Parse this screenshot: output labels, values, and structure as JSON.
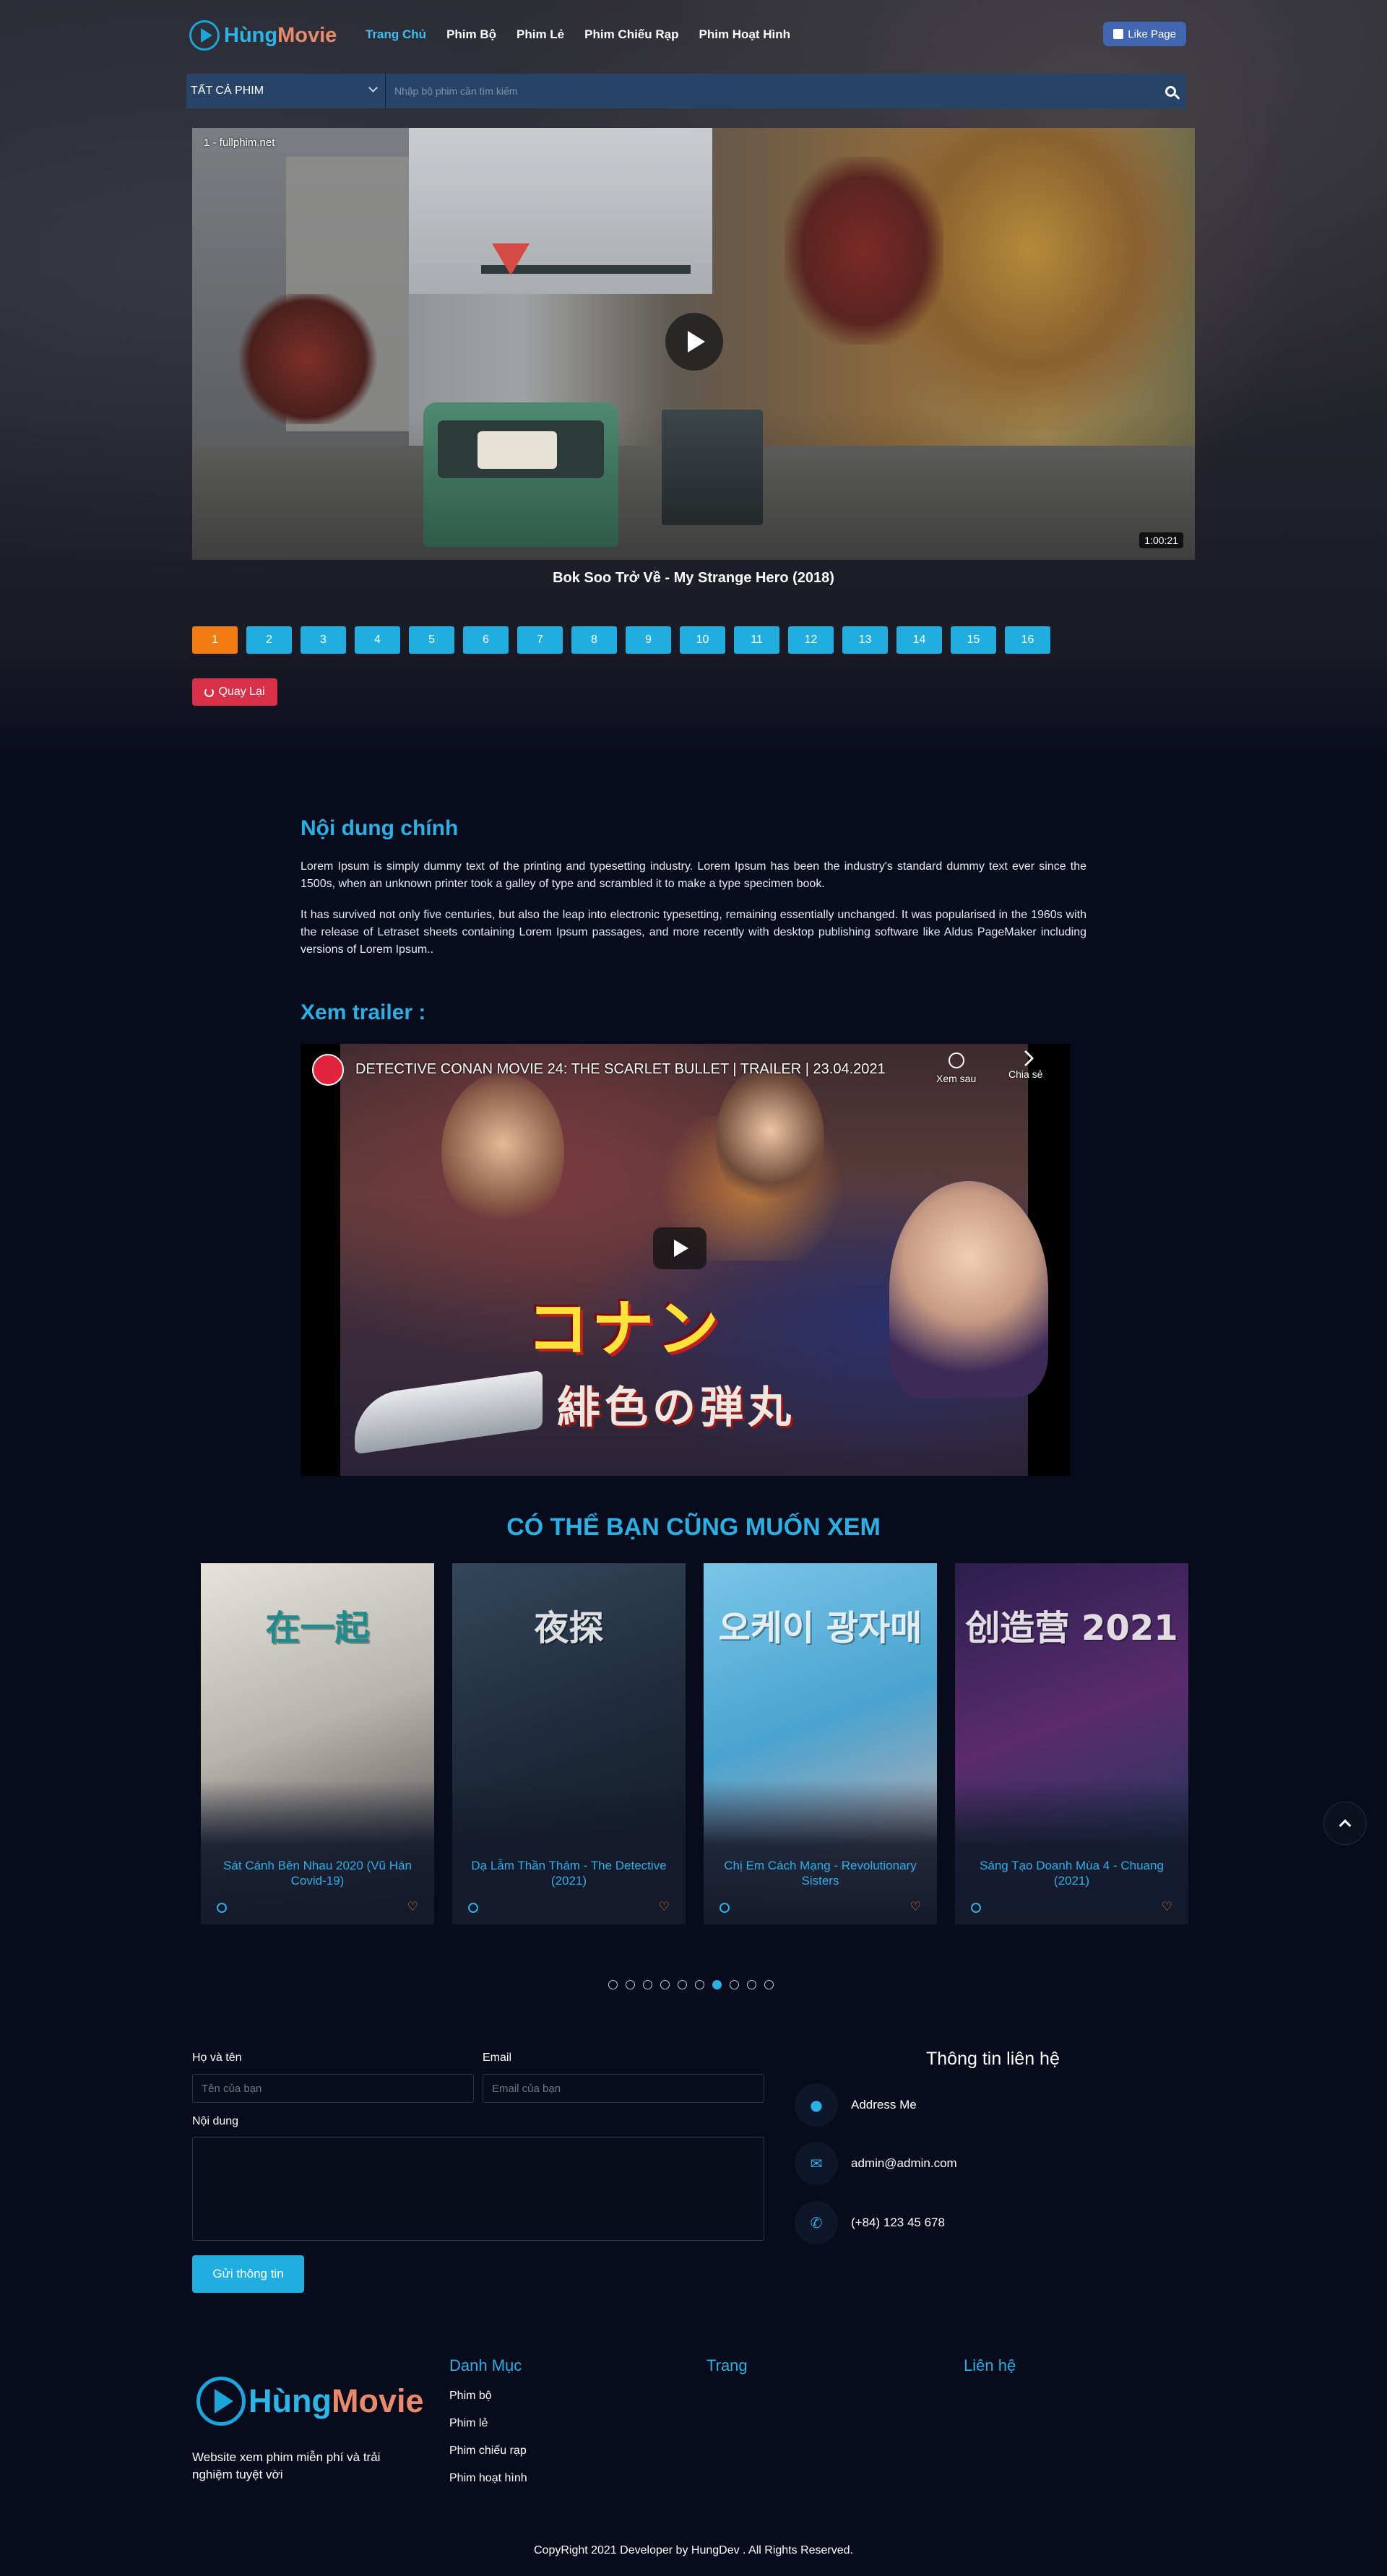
{
  "brand": {
    "part1": "Hùng",
    "part2": "Movie"
  },
  "nav": {
    "links": [
      "Trang Chủ",
      "Phim Bộ",
      "Phim Lẻ",
      "Phim Chiếu Rạp",
      "Phim Hoạt Hình"
    ],
    "active_index": 0,
    "like_label": "Like Page"
  },
  "search": {
    "category": "TẤT CẢ PHIM",
    "placeholder": "Nhập bộ phim cần tìm kiếm"
  },
  "player": {
    "source_label": "1 - fullphim.net",
    "duration": "1:00:21",
    "movie_title": "Bok Soo Trở Về - My Strange Hero (2018)"
  },
  "episodes": {
    "items": [
      "1",
      "2",
      "3",
      "4",
      "5",
      "6",
      "7",
      "8",
      "9",
      "10",
      "11",
      "12",
      "13",
      "14",
      "15",
      "16"
    ],
    "current": "1"
  },
  "back_label": "Quay Lại",
  "content": {
    "heading": "Nội dung chính",
    "paragraph1": "Lorem Ipsum is simply dummy text of the printing and typesetting industry. Lorem Ipsum has been the industry's standard dummy text ever since the 1500s, when an unknown printer took a galley of type and scrambled it to make a type specimen book.",
    "paragraph2": "It has survived not only five centuries, but also the leap into electronic typesetting, remaining essentially unchanged. It was popularised in the 1960s with the release of Letraset sheets containing Lorem Ipsum passages, and more recently with desktop publishing software like Aldus PageMaker including versions of Lorem Ipsum.."
  },
  "trailer": {
    "heading": "Xem trailer :",
    "video_title": "DETECTIVE CONAN MOVIE 24: THE SCARLET BULLET | TRAILER | 23.04.2021",
    "watch_later": "Xem sau",
    "share": "Chia sẻ",
    "art_title_jp": "コナン",
    "art_subtitle_jp": "緋色の弾丸"
  },
  "recommend": {
    "heading": "CÓ THỂ BẠN CŨNG MUỐN XEM",
    "cards": [
      {
        "title": "Sát Cánh Bên Nhau 2020 (Vũ Hán Covid-19)",
        "poster_text": "在一起",
        "palette": [
          "#e6e2dc",
          "#b7b3ad",
          "#3b3a3a"
        ]
      },
      {
        "title": "Dạ Lẫm Thần Thám - The Detective (2021)",
        "poster_text": "夜探",
        "palette": [
          "#33475a",
          "#1f2c3d",
          "#0f1622"
        ]
      },
      {
        "title": "Chị Em Cách Mạng - Revolutionary Sisters",
        "poster_text": "오케이 광자매",
        "palette": [
          "#79c6e8",
          "#4aa3cf",
          "#e7b0a4"
        ]
      },
      {
        "title": "Sáng Tạo Doanh Mùa 4 - Chuang (2021)",
        "poster_text": "创造营 2021",
        "palette": [
          "#2b1f4d",
          "#5a2b6d",
          "#0e3d52"
        ]
      }
    ],
    "dot_count": 10,
    "active_dot": 6
  },
  "contact_form": {
    "name_label": "Họ và tên",
    "name_placeholder": "Tên của bạn",
    "email_label": "Email",
    "email_placeholder": "Email của bạn",
    "message_label": "Nội dung",
    "submit_label": "Gửi thông tin"
  },
  "contact_info": {
    "heading": "Thông tin liên hệ",
    "address": "Address Me",
    "email": "admin@admin.com",
    "phone": "(+84) 123 45 678"
  },
  "footer": {
    "description": "Website xem phim miễn phí và trải nghiệm tuyệt vời",
    "col1_title": "Danh Mục",
    "col1_links": [
      "Phim bộ",
      "Phim lẻ",
      "Phim chiếu rạp",
      "Phim hoạt hình"
    ],
    "col2_title": "Trang",
    "col3_title": "Liên hệ",
    "copyright": "CopyRight 2021 Developer by HungDev . All Rights Reserved."
  },
  "colors": {
    "accent": "#2bb0e3",
    "episode_active": "#f07c12",
    "back_button": "#d9304a",
    "like_button": "#4267b2"
  }
}
